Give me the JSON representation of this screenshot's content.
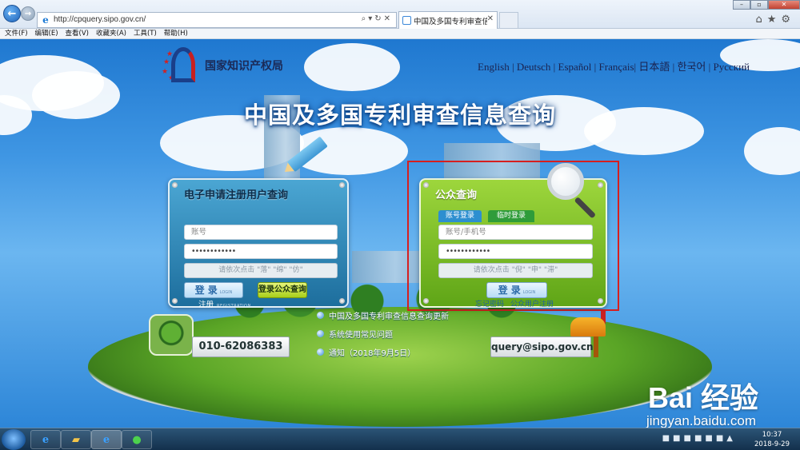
{
  "browser": {
    "url": "http://cpquery.sipo.gov.cn/",
    "tab_title": "中国及多国专利审查信息查...",
    "menu": [
      "文件(F)",
      "编辑(E)",
      "查看(V)",
      "收藏夹(A)",
      "工具(T)",
      "帮助(H)"
    ]
  },
  "header": {
    "org_name": "国家知识产权局",
    "languages": "English | Deutsch | Español | Français| 日本語 | 한국어 | Русский",
    "title": "中国及多国专利审查信息查询"
  },
  "left_panel": {
    "title": "电子申请注册用户查询",
    "account_placeholder": "账号",
    "password_mask": "••••••••••••",
    "captcha_hint": "请依次点击 \"落\" \"绵\" \"仿\"",
    "login_label": "登 录",
    "login_sub": "LOGIN",
    "public_query_label": "登录公众查询",
    "register_label": "注册",
    "register_sub": "REGISTRATION"
  },
  "right_panel": {
    "title": "公众查询",
    "tab_account": "账号登录",
    "tab_temp": "临时登录",
    "account_placeholder": "账号/手机号",
    "password_mask": "••••••••••••",
    "captcha_hint": "请依次点击 \"倪\" \"申\" \"滞\"",
    "login_label": "登 录",
    "login_sub": "LOGIN",
    "forgot_label": "忘记密码",
    "register_label": "公众用户注册"
  },
  "news": [
    "中国及多国专利审查信息查询更新",
    "系统使用常见问题",
    "通知（2018年9月5日）"
  ],
  "contact": {
    "phone": "010-62086383",
    "email": "query@sipo.gov.cn"
  },
  "watermark": {
    "brand": "Bai 经验",
    "url": "jingyan.baidu.com"
  },
  "taskbar": {
    "time": "10:37",
    "date": "2018-9-29"
  },
  "colors": {
    "highlight_frame": "#d61f1f",
    "left_panel": "#2a84b8",
    "right_panel": "#7cbf24"
  }
}
